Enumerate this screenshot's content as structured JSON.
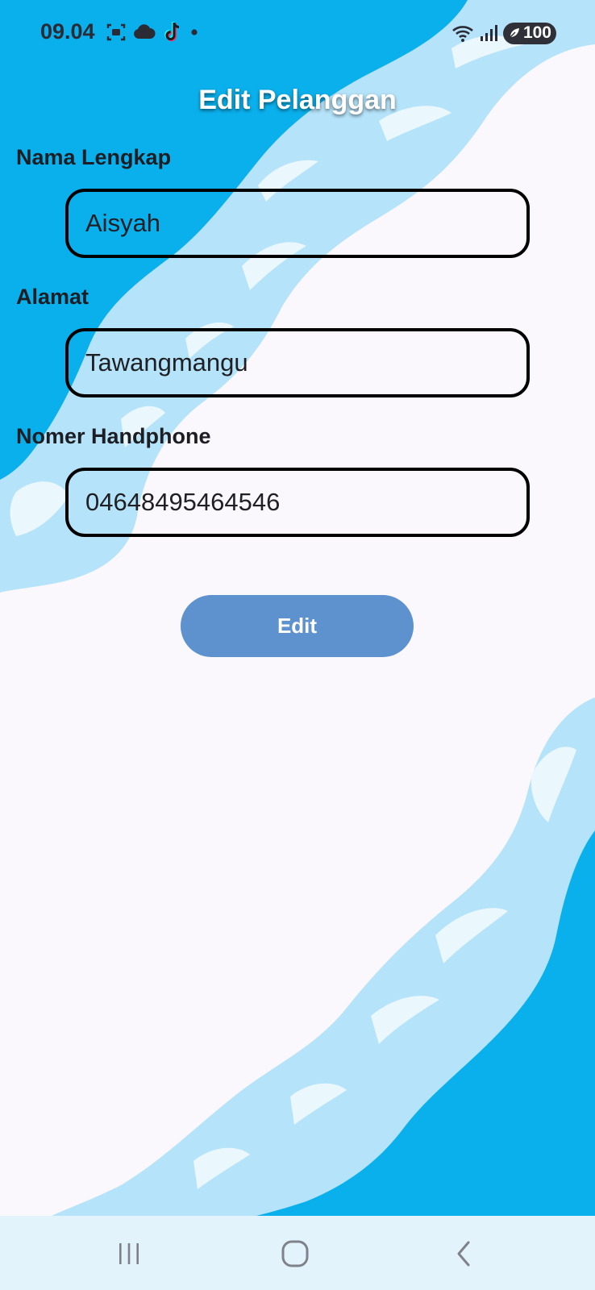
{
  "status_bar": {
    "time": "09.04",
    "battery_level": "100",
    "left_icons": [
      "screenshot-icon",
      "cloud-icon",
      "tiktok-icon",
      "notification-dot-icon"
    ],
    "right_icons": [
      "wifi-icon",
      "signal-icon",
      "battery-icon"
    ]
  },
  "page": {
    "title": "Edit Pelanggan"
  },
  "form": {
    "fields": [
      {
        "label": "Nama Lengkap",
        "value": "Aisyah"
      },
      {
        "label": "Alamat",
        "value": "Tawangmangu"
      },
      {
        "label": "Nomer Handphone",
        "value": "04648495464546"
      }
    ],
    "submit_label": "Edit"
  },
  "navigation": {
    "buttons": [
      "recent-apps",
      "home",
      "back"
    ]
  },
  "colors": {
    "accent_button": "#5E92CE",
    "background": "#FBF8FD",
    "water_primary": "#0AB0EC",
    "water_light": "#B5E3F9",
    "nav_bar": "#E3F3FC"
  }
}
